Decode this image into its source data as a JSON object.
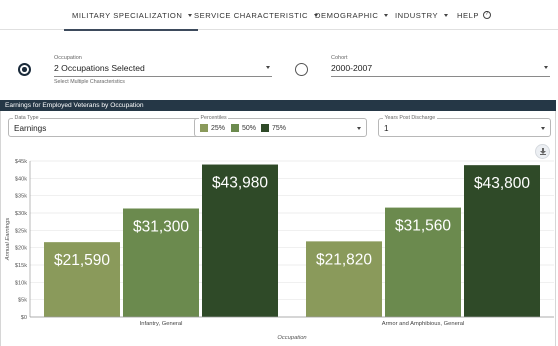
{
  "nav": {
    "items": [
      {
        "label": "MILITARY SPECIALIZATION",
        "active": true
      },
      {
        "label": "SERVICE CHARACTERISTIC",
        "active": false
      },
      {
        "label": "DEMOGRAPHIC",
        "active": false
      },
      {
        "label": "INDUSTRY",
        "active": false
      },
      {
        "label": "HELP",
        "active": false
      }
    ],
    "help_icon": "?"
  },
  "filters": {
    "occupation": {
      "label": "Occupation",
      "value": "2 Occupations Selected",
      "helper": "Select Multiple Characteristics",
      "selected": true
    },
    "cohort": {
      "label": "Cohort",
      "value": "2000-2007",
      "selected": false
    }
  },
  "panel": {
    "title": "Earnings for Employed Veterans by Occupation",
    "data_type": {
      "label": "Data Type",
      "value": "Earnings"
    },
    "percentiles": {
      "label": "Percentiles",
      "items": [
        {
          "label": "25%",
          "color": "#8a9a5b"
        },
        {
          "label": "50%",
          "color": "#6b8a4e"
        },
        {
          "label": "75%",
          "color": "#2f4a28"
        }
      ]
    },
    "years": {
      "label": "Years Post Discharge",
      "value": "1"
    },
    "download_icon": "download-icon"
  },
  "chart_data": {
    "type": "bar",
    "xlabel": "Occupation",
    "ylabel": "Annual Earnings",
    "ylim": [
      0,
      45000
    ],
    "yticks": [
      "$0",
      "$5k",
      "$10k",
      "$15k",
      "$20k",
      "$25k",
      "$30k",
      "$35k",
      "$40k",
      "$45k"
    ],
    "grid": true,
    "categories": [
      "Infantry, General",
      "Armor and Amphibious, General"
    ],
    "series": [
      {
        "name": "25%",
        "color": "#8a9a5b",
        "values": [
          21590,
          21820
        ],
        "labels": [
          "$21,590",
          "$21,820"
        ]
      },
      {
        "name": "50%",
        "color": "#6b8a4e",
        "values": [
          31300,
          31560
        ],
        "labels": [
          "$31,300",
          "$31,560"
        ]
      },
      {
        "name": "75%",
        "color": "#2f4a28",
        "values": [
          43980,
          43800
        ],
        "labels": [
          "$43,980",
          "$43,800"
        ]
      }
    ]
  }
}
